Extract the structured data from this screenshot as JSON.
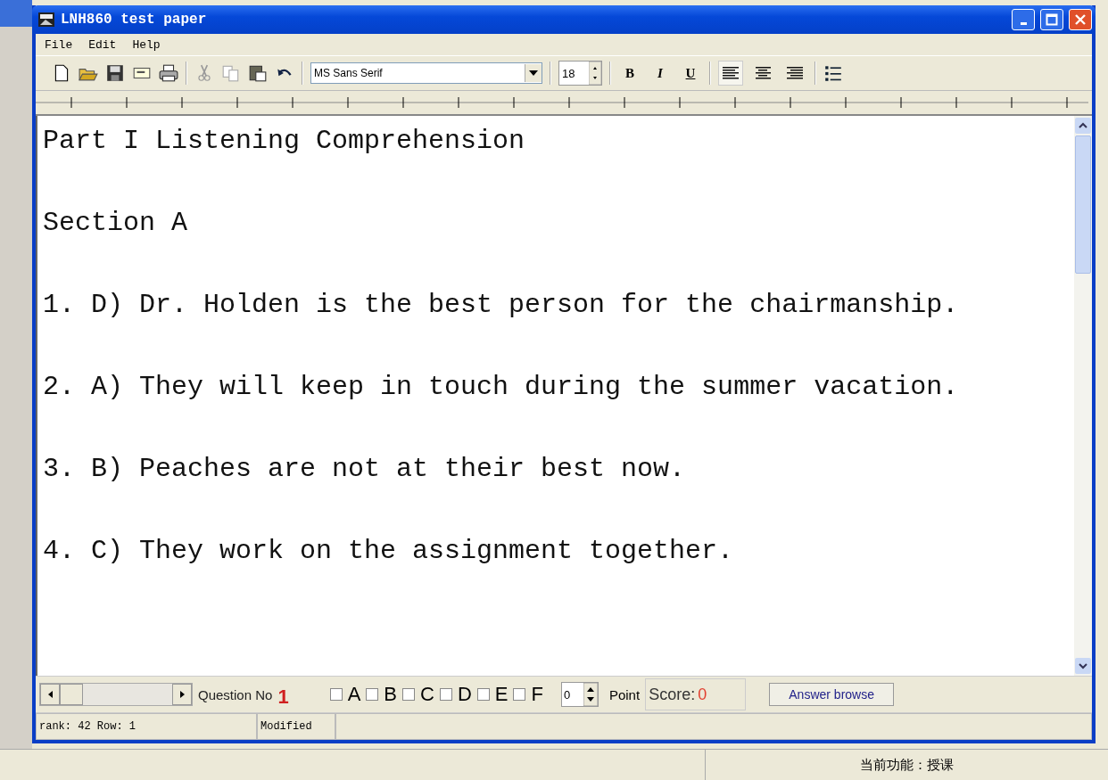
{
  "window": {
    "title": "LNH860 test paper"
  },
  "menu": [
    "File",
    "Edit",
    "Help"
  ],
  "toolbar": {
    "font_name": "MS Sans Serif",
    "font_size": "18",
    "format_buttons": [
      {
        "label": "B",
        "kind": "bold"
      },
      {
        "label": "I",
        "kind": "italic"
      },
      {
        "label": "U",
        "kind": "underline"
      }
    ],
    "alignment": [
      {
        "selected": true
      },
      {
        "selected": false
      },
      {
        "selected": false
      }
    ]
  },
  "document": [
    "Part I Listening Comprehension",
    "Section A",
    "1. D) Dr. Holden is the best person for the chairmanship.",
    "2. A) They will keep in touch during the summer vacation.",
    "3. B) Peaches are not at their best now.",
    "4. C) They work on the assignment together."
  ],
  "question_bar": {
    "label": "Question No",
    "number": "1",
    "options": [
      {
        "label": "A",
        "checked": false
      },
      {
        "label": "B",
        "checked": false
      },
      {
        "label": "C",
        "checked": false
      },
      {
        "label": "D",
        "checked": false
      },
      {
        "label": "E",
        "checked": false
      },
      {
        "label": "F",
        "checked": false
      }
    ],
    "points": "0",
    "points_label": "Point",
    "score_label": "Score:",
    "score_value": "0",
    "answer_button": "Answer browse"
  },
  "status_bar": [
    "rank: 42 Row:  1",
    "Modified"
  ],
  "outer_status": "当前功能：授课"
}
